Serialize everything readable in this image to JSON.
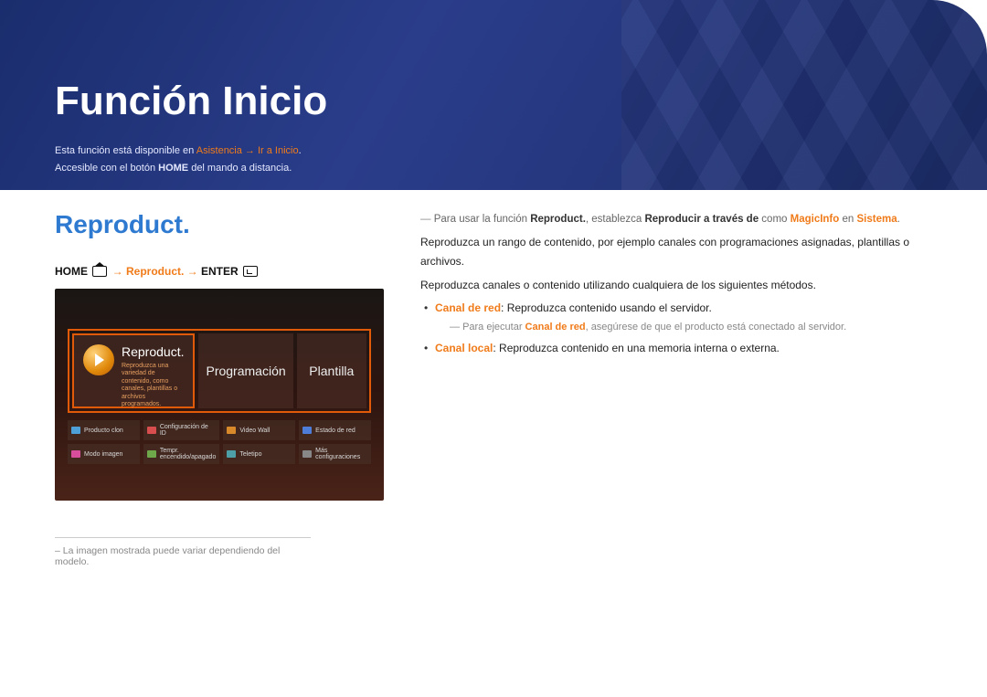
{
  "header": {
    "page_title": "Función Inicio",
    "intro_prefix": "Esta función está disponible en ",
    "intro_path": "Asistencia → Ir a Inicio",
    "intro_suffix": ".",
    "intro_line2_a": "Accesible con el botón ",
    "intro_line2_b": "HOME",
    "intro_line2_c": " del mando a distancia."
  },
  "section": {
    "title": "Reproduct.",
    "breadcrumb_home": "HOME ",
    "breadcrumb_mid": " → Reproduct. → ",
    "breadcrumb_enter": "ENTER "
  },
  "screenshot": {
    "tile_main_title": "Reproduct.",
    "tile_main_desc": "Reproduzca una variedad de contenido, como canales, plantillas o archivos programados.",
    "tile_prog": "Programación",
    "tile_plantilla": "Plantilla",
    "minis": [
      "Producto clon",
      "Configuración de ID",
      "Video Wall",
      "Estado de red",
      "Modo imagen",
      "Tempr. encendido/apagado",
      "Teletipo",
      "Más configuraciones"
    ]
  },
  "image_note": "La imagen mostrada puede variar dependiendo del modelo.",
  "body": {
    "note1_a": "Para usar la función ",
    "note1_b": "Reproduct.",
    "note1_c": ", establezca ",
    "note1_d": "Reproducir a través de",
    "note1_e": " como ",
    "note1_f": "MagicInfo",
    "note1_g": " en ",
    "note1_h": "Sistema",
    "note1_i": ".",
    "p1": "Reproduzca un rango de contenido, por ejemplo canales con programaciones asignadas, plantillas o archivos.",
    "p2": "Reproduzca canales o contenido utilizando cualquiera de los siguientes métodos.",
    "li1_a": "Canal de red",
    "li1_b": ": Reproduzca contenido usando el servidor.",
    "li1_note_a": "Para ejecutar ",
    "li1_note_b": "Canal de red",
    "li1_note_c": ", asegúrese de que el producto está conectado al servidor.",
    "li2_a": "Canal local",
    "li2_b": ": Reproduzca contenido en una memoria interna o externa."
  }
}
